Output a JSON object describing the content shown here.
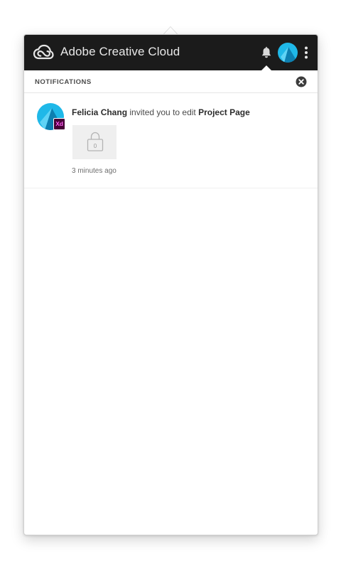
{
  "window": {
    "title": "Adobe Creative Cloud",
    "logo_icon": "creative-cloud-logo",
    "icons": [
      "bell-icon",
      "user-avatar",
      "more-vertical-icon"
    ]
  },
  "notifications_panel": {
    "heading": "NOTIFICATIONS",
    "close_icon": "close-circle-icon"
  },
  "notifications": [
    {
      "actor": "Felicia Chang",
      "action": " invited you to edit ",
      "target": "Project Page",
      "app_badge": "Xd",
      "thumbnail_count": "0",
      "thumbnail_icon": "lock-icon",
      "time": "3 minutes ago"
    }
  ],
  "colors": {
    "titlebar_bg": "#1b1b1b",
    "avatar_cyan": "#1fb8e8",
    "xd_badge_bg": "#470137",
    "xd_badge_text": "#ff61f6"
  }
}
